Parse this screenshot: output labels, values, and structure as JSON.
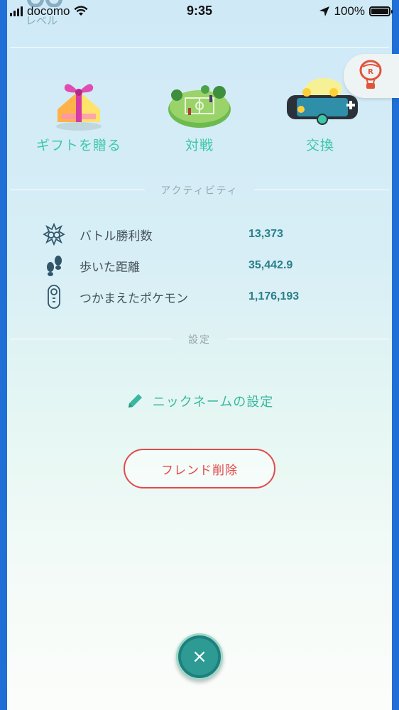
{
  "status_bar": {
    "carrier": "docomo",
    "time": "9:35",
    "battery": "100%"
  },
  "header": {
    "level_label": "レベル"
  },
  "actions": [
    {
      "label": "ギフトを贈る",
      "icon": "gift-icon"
    },
    {
      "label": "対戦",
      "icon": "battle-field-icon"
    },
    {
      "label": "交換",
      "icon": "trade-icon"
    }
  ],
  "activity": {
    "title": "アクティビティ",
    "rows": [
      {
        "label": "バトル勝利数",
        "value": "13,373",
        "icon": "battle-wins-icon"
      },
      {
        "label": "歩いた距離",
        "value": "35,442.9",
        "icon": "footprints-icon"
      },
      {
        "label": "つかまえたポケモン",
        "value": "1,176,193",
        "icon": "pokedex-icon"
      }
    ]
  },
  "settings": {
    "title": "設定",
    "nickname_label": "ニックネームの設定",
    "remove_friend_label": "フレンド削除"
  },
  "close_button": "×",
  "colors": {
    "accent_green": "#3cc8a8",
    "stat_value": "#2a7f8a",
    "danger": "#e24a4a",
    "frame_blue": "#1f6fd6"
  }
}
